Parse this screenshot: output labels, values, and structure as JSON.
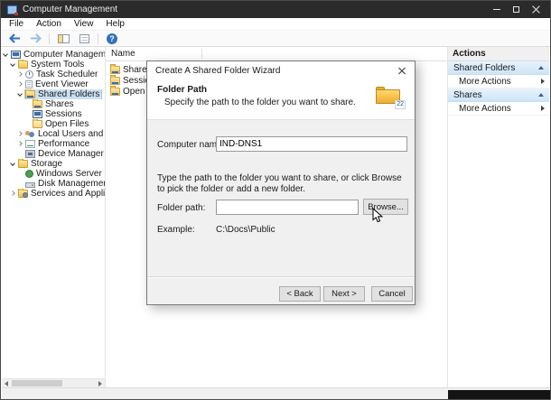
{
  "window": {
    "title": "Computer Management"
  },
  "menu": {
    "items": [
      "File",
      "Action",
      "View",
      "Help"
    ]
  },
  "toolbar": {
    "buttons": [
      "back-arrow",
      "forward-arrow",
      "show-console-tree",
      "properties",
      "help"
    ],
    "help_glyph": "?"
  },
  "tree": {
    "items": [
      {
        "label": "Computer Management (Local)",
        "level": 0,
        "state": "expanded",
        "icon": "computer",
        "selected": false
      },
      {
        "label": "System Tools",
        "level": 1,
        "state": "expanded",
        "icon": "folder",
        "selected": false
      },
      {
        "label": "Task Scheduler",
        "level": 2,
        "state": "collapsed",
        "icon": "clock",
        "selected": false
      },
      {
        "label": "Event Viewer",
        "level": 2,
        "state": "collapsed",
        "icon": "log",
        "selected": false
      },
      {
        "label": "Shared Folders",
        "level": 2,
        "state": "expanded",
        "icon": "shared-folder",
        "selected": true
      },
      {
        "label": "Shares",
        "level": 3,
        "state": "leaf",
        "icon": "shared-folder",
        "selected": false
      },
      {
        "label": "Sessions",
        "level": 3,
        "state": "leaf",
        "icon": "computer",
        "selected": false
      },
      {
        "label": "Open Files",
        "level": 3,
        "state": "leaf",
        "icon": "open-folder",
        "selected": false
      },
      {
        "label": "Local Users and Groups",
        "level": 2,
        "state": "collapsed",
        "icon": "users",
        "selected": false
      },
      {
        "label": "Performance",
        "level": 2,
        "state": "collapsed",
        "icon": "chart",
        "selected": false
      },
      {
        "label": "Device Manager",
        "level": 2,
        "state": "leaf",
        "icon": "device",
        "selected": false
      },
      {
        "label": "Storage",
        "level": 1,
        "state": "expanded",
        "icon": "folder",
        "selected": false
      },
      {
        "label": "Windows Server Backup",
        "level": 2,
        "state": "leaf",
        "icon": "backup",
        "selected": false
      },
      {
        "label": "Disk Management",
        "level": 2,
        "state": "leaf",
        "icon": "disk",
        "selected": false
      },
      {
        "label": "Services and Applications",
        "level": 1,
        "state": "collapsed",
        "icon": "gear-folder",
        "selected": false
      }
    ]
  },
  "list": {
    "header": "Name",
    "items": [
      "Shares",
      "Sessions",
      "Open Files"
    ]
  },
  "actions": {
    "title": "Actions",
    "sections": [
      {
        "title": "Shared Folders",
        "more": "More Actions"
      },
      {
        "title": "Shares",
        "more": "More Actions"
      }
    ]
  },
  "dialog": {
    "title": "Create A Shared Folder Wizard",
    "heading": "Folder Path",
    "subheading": "Specify the path to the folder you want to share.",
    "folder_icon_badge": "22",
    "computer_name_label": "Computer name:",
    "computer_name_value": "IND-DNS1",
    "instruction": "Type the path to the folder you want to share, or click Browse to pick the folder or add a new folder.",
    "folder_path_label": "Folder path:",
    "folder_path_value": "",
    "browse_label": "Browse...",
    "example_label": "Example:",
    "example_value": "C:\\Docs\\Public",
    "back_label": "< Back",
    "next_label": "Next >",
    "cancel_label": "Cancel"
  }
}
